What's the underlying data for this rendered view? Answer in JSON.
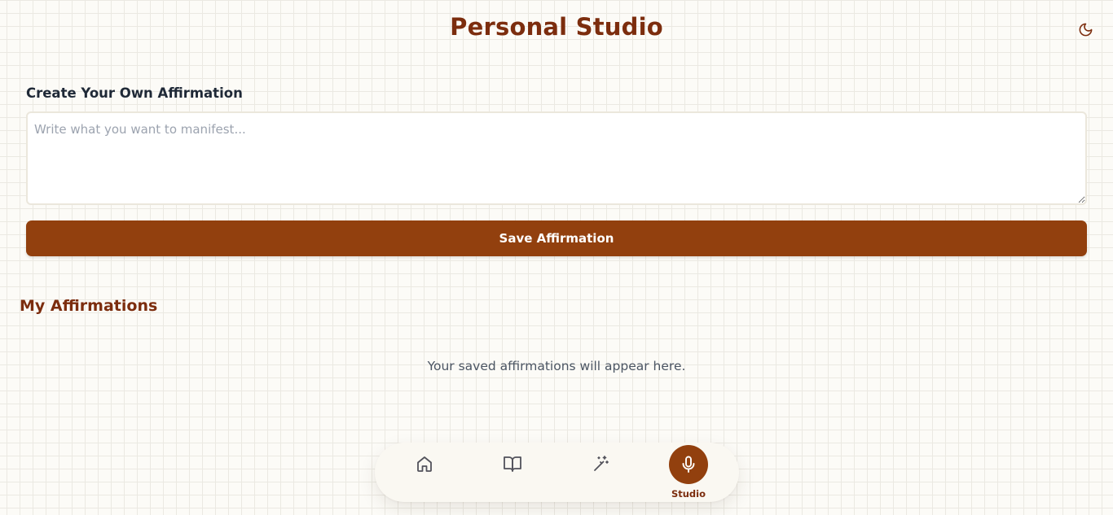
{
  "header": {
    "title": "Personal Studio",
    "theme_toggle_icon": "moon-icon"
  },
  "create": {
    "label": "Create Your Own Affirmation",
    "input_value": "",
    "input_placeholder": "Write what you want to manifest...",
    "save_label": "Save Affirmation"
  },
  "affirmations": {
    "title": "My Affirmations",
    "empty_text": "Your saved affirmations will appear here."
  },
  "nav": {
    "items": [
      {
        "icon": "home-icon",
        "label": "",
        "active": false
      },
      {
        "icon": "book-open-icon",
        "label": "",
        "active": false
      },
      {
        "icon": "magic-wand-icon",
        "label": "",
        "active": false
      },
      {
        "icon": "microphone-icon",
        "label": "Studio",
        "active": true
      }
    ]
  },
  "colors": {
    "brand": "#92400e",
    "title": "#7c2d0e",
    "background": "#fcfbf7",
    "nav_icon": "#52525b"
  }
}
